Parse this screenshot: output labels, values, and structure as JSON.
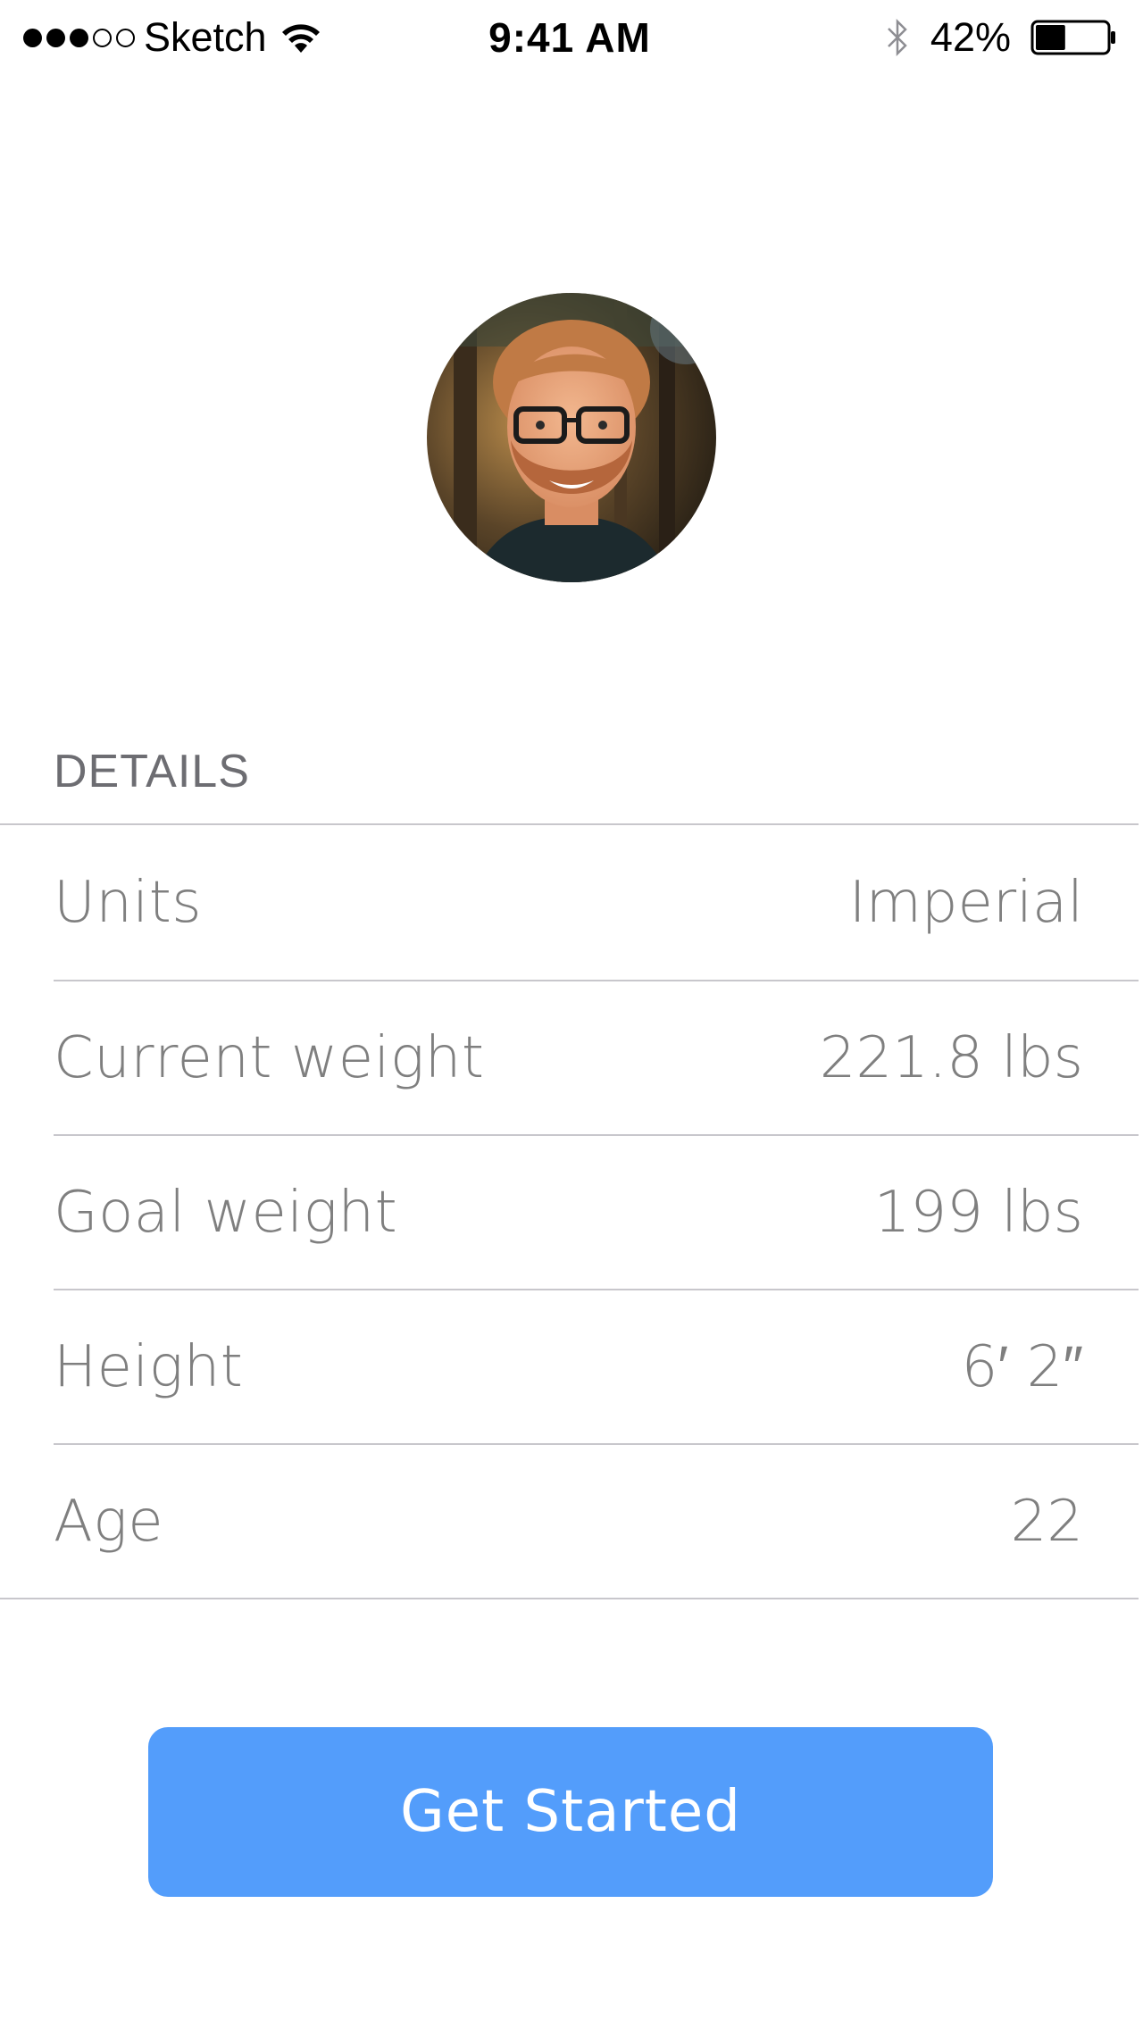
{
  "status_bar": {
    "carrier": "Sketch",
    "time": "9:41 AM",
    "battery_percent": "42%",
    "battery_level": 0.42,
    "signal_bars_filled": 3,
    "signal_bars_total": 5,
    "icons": [
      "signal-dots",
      "wifi-icon",
      "bluetooth-icon",
      "battery-icon"
    ]
  },
  "profile": {
    "avatar": "profile-photo"
  },
  "details": {
    "header": "DETAILS",
    "rows": [
      {
        "label": "Units",
        "value": "Imperial"
      },
      {
        "label": "Current weight",
        "value": "221.8 lbs"
      },
      {
        "label": "Goal weight",
        "value": "199 lbs"
      },
      {
        "label": "Height",
        "value": "6′ 2″"
      },
      {
        "label": "Age",
        "value": "22"
      }
    ]
  },
  "actions": {
    "primary_label": "Get Started"
  },
  "colors": {
    "accent": "#539dfb",
    "text_secondary": "#7f7f7f",
    "separator": "#c8c7cc",
    "background": "#ffffff"
  }
}
